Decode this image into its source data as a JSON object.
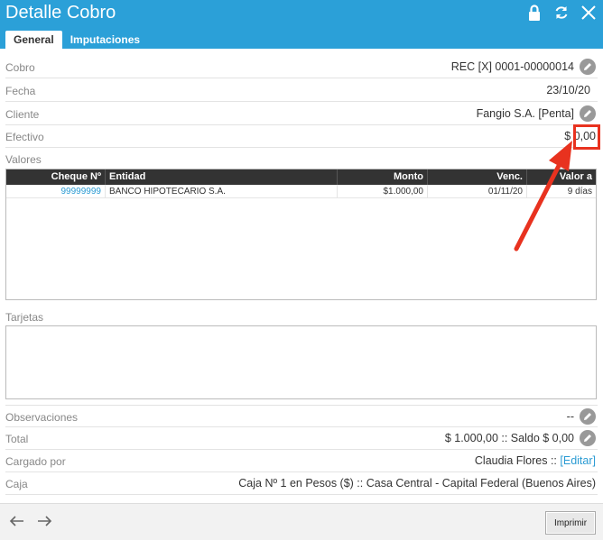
{
  "header": {
    "title": "Detalle Cobro",
    "icons": [
      "lock-icon",
      "refresh-icon",
      "close-icon"
    ]
  },
  "tabs": [
    {
      "label": "General",
      "active": true
    },
    {
      "label": "Imputaciones",
      "active": false
    }
  ],
  "fields": {
    "cobro": {
      "label": "Cobro",
      "value": "REC [X] 0001-00000014"
    },
    "fecha": {
      "label": "Fecha",
      "value": "23/10/20"
    },
    "cliente": {
      "label": "Cliente",
      "value": "Fangio S.A. [Penta]"
    },
    "efectivo": {
      "label": "Efectivo",
      "value": "$ 0,00"
    }
  },
  "valores": {
    "label": "Valores",
    "columns": [
      "Cheque Nº",
      "Entidad",
      "Monto",
      "Venc.",
      "Valor a"
    ],
    "rows": [
      {
        "cheque": "99999999",
        "entidad": "BANCO HIPOTECARIO S.A.",
        "monto": "$1.000,00",
        "venc": "01/11/20",
        "valor": "9 días"
      }
    ]
  },
  "tarjetas": {
    "label": "Tarjetas"
  },
  "summary": {
    "observaciones": {
      "label": "Observaciones",
      "value": "--"
    },
    "total": {
      "label": "Total",
      "value": "$ 1.000,00 :: Saldo $ 0,00"
    },
    "cargado": {
      "label": "Cargado por",
      "value": "Claudia Flores ::",
      "link": "[Editar]"
    },
    "caja": {
      "label": "Caja",
      "value": "Caja Nº 1 en Pesos ($) :: Casa Central - Capital Federal (Buenos Aires)"
    }
  },
  "footer": {
    "print_label": "Imprimir"
  },
  "colors": {
    "header": "#2ba0d8",
    "link": "#2a9bd3",
    "annotation": "#e8321f"
  }
}
